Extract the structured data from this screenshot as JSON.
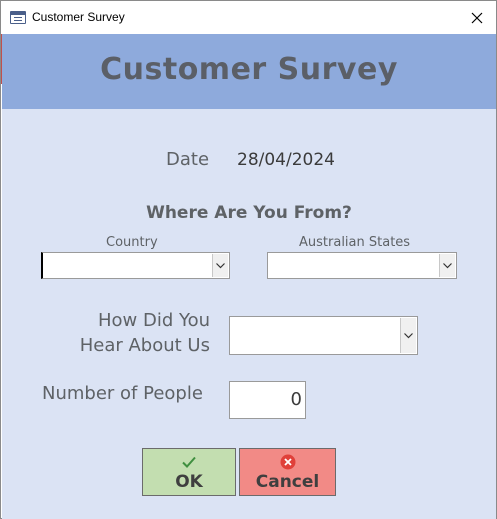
{
  "window": {
    "title": "Customer Survey"
  },
  "header": {
    "title": "Customer Survey"
  },
  "form": {
    "date_label": "Date",
    "date_value": "28/04/2024",
    "section_title": "Where Are You From?",
    "country_label": "Country",
    "country_value": "",
    "states_label": "Australian States",
    "states_value": "",
    "hear_label_line1": "How Did You",
    "hear_label_line2": "Hear About Us",
    "hear_value": "",
    "people_label": "Number of People",
    "people_value": "0"
  },
  "buttons": {
    "ok_label": "OK",
    "cancel_label": "Cancel"
  },
  "colors": {
    "header_bg": "#8eaadc",
    "body_bg": "#dbe3f4",
    "ok_bg": "#c3deb0",
    "cancel_bg": "#f28a86",
    "check_icon": "#3f8f3f",
    "cancel_icon": "#e0403a"
  },
  "icons": {
    "app": "form-icon",
    "close": "close-icon",
    "ok": "checkmark-icon",
    "cancel": "cancel-x-circle-icon",
    "dropdown": "chevron-down-icon"
  }
}
